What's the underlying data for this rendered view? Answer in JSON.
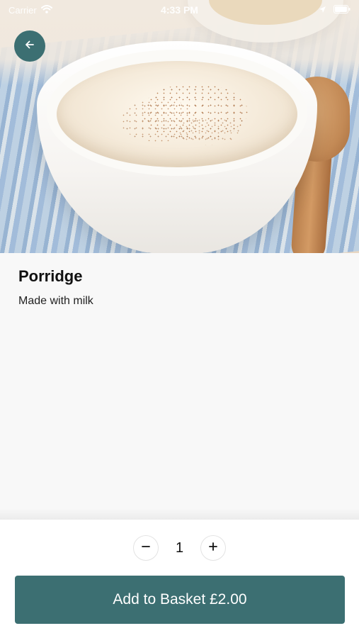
{
  "status_bar": {
    "carrier": "Carrier",
    "time": "4:33 PM"
  },
  "item": {
    "name": "Porridge",
    "description": "Made with milk"
  },
  "quantity": {
    "value": "1"
  },
  "cta": {
    "label": "Add to Basket £2.00"
  },
  "colors": {
    "accent": "#3c6f72",
    "background": "#f8f8f8",
    "panel": "#ffffff"
  },
  "icons": {
    "back": "arrow-left-icon",
    "decrease": "minus-icon",
    "increase": "plus-icon",
    "wifi": "wifi-icon",
    "location": "location-arrow-icon",
    "battery": "battery-icon"
  }
}
